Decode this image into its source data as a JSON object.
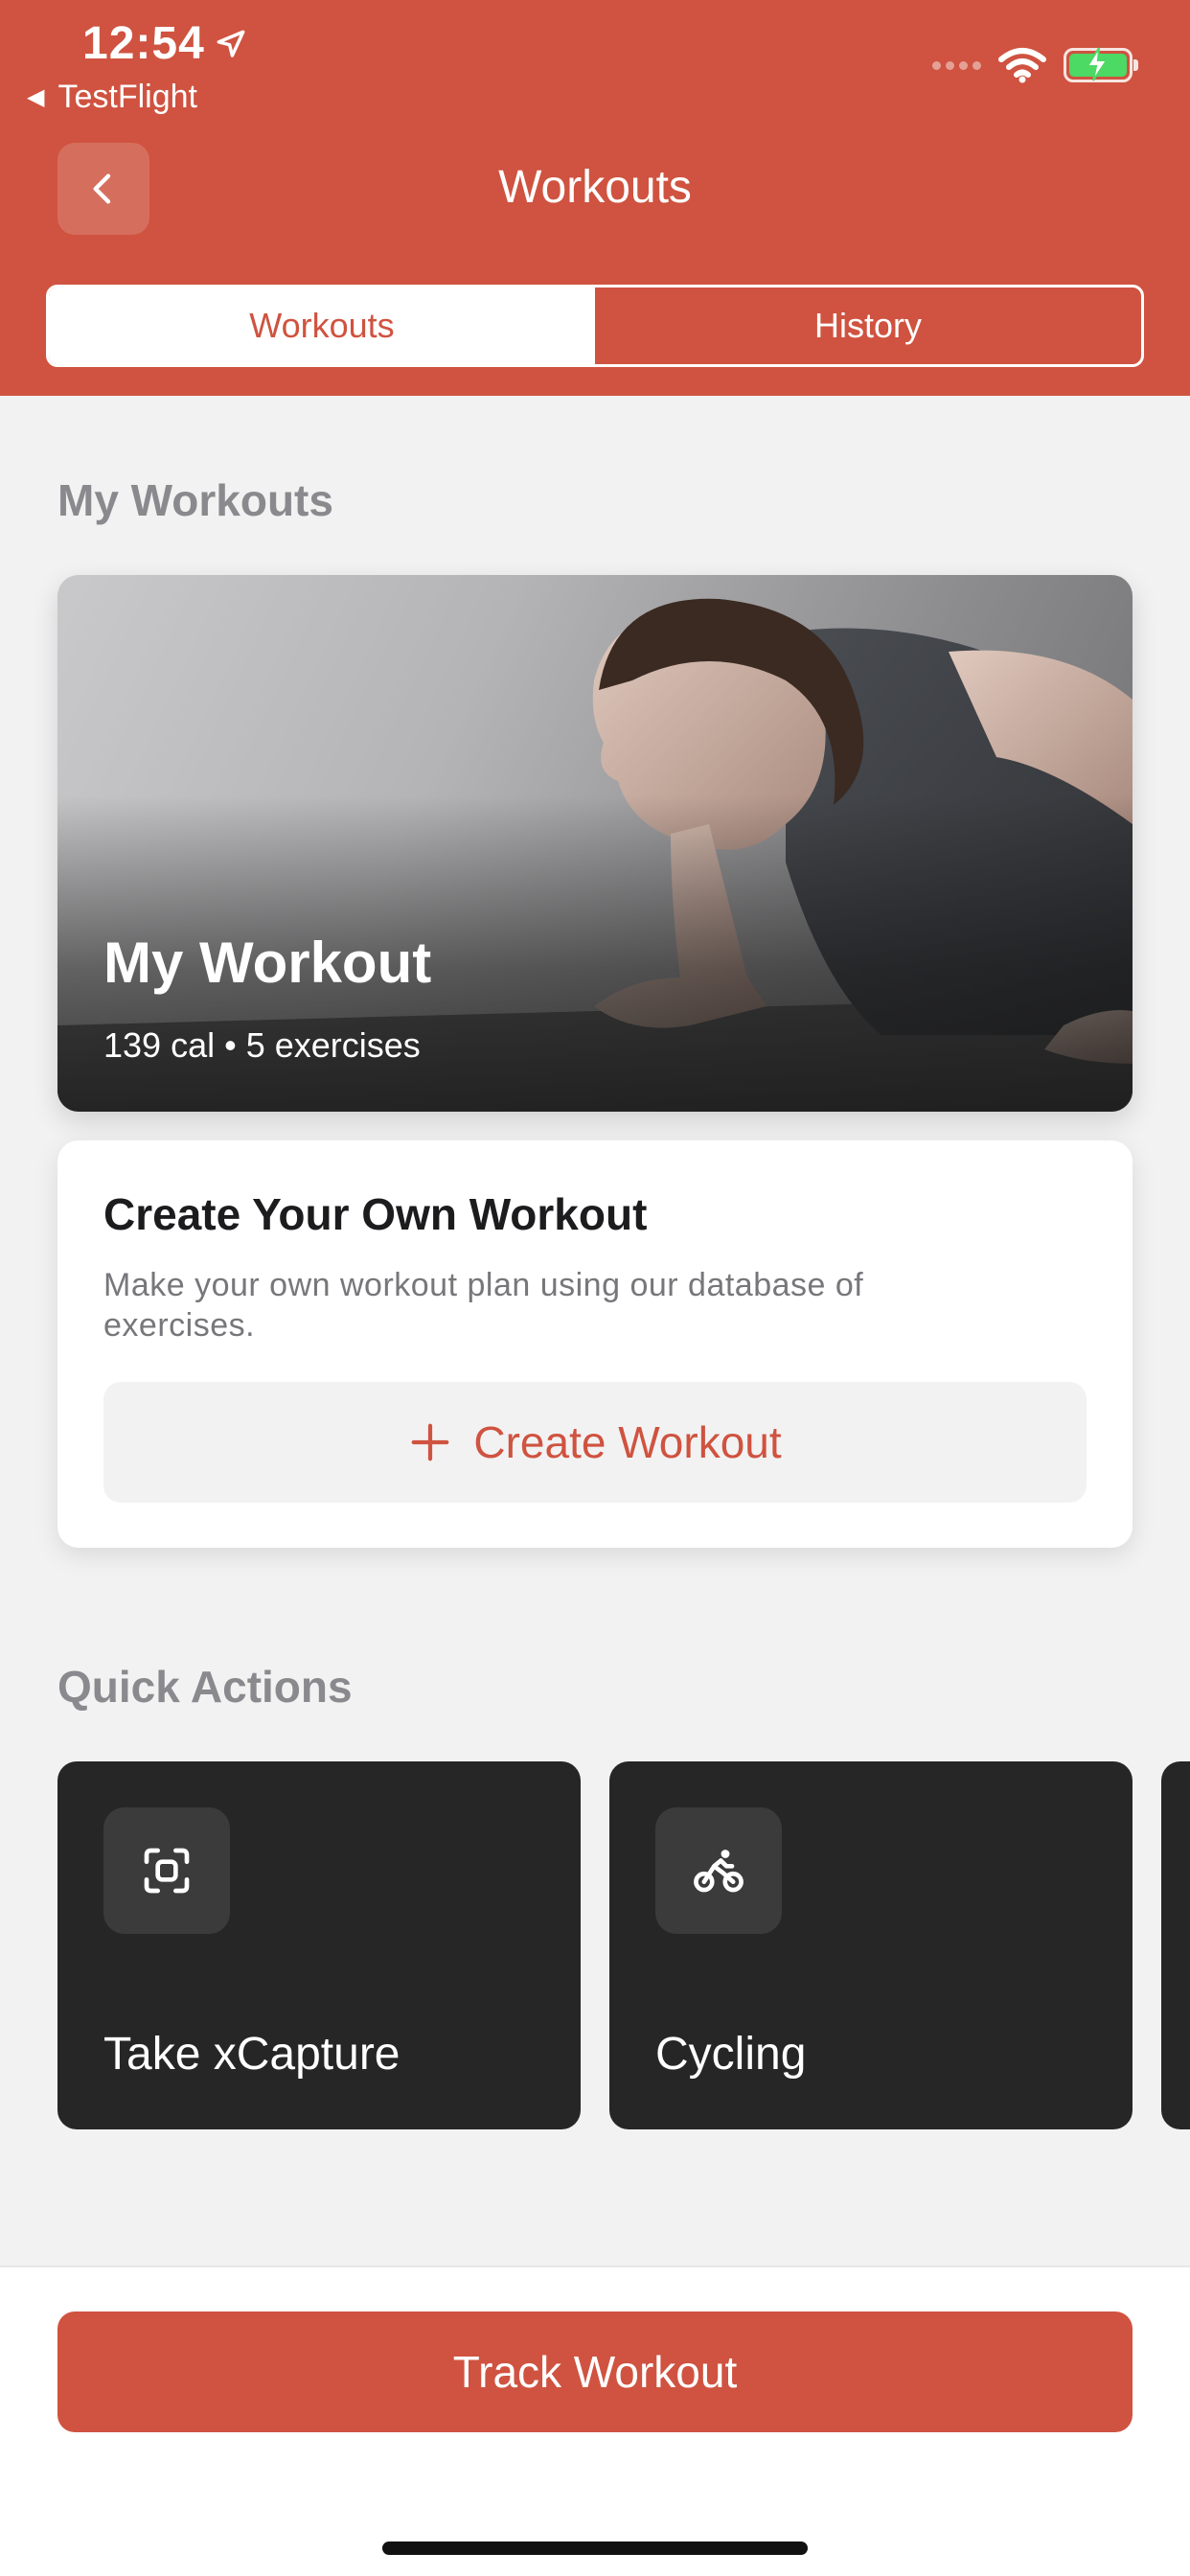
{
  "status_bar": {
    "time": "12:54",
    "back_app": "TestFlight"
  },
  "nav": {
    "title": "Workouts"
  },
  "segments": [
    {
      "label": "Workouts",
      "active": true
    },
    {
      "label": "History",
      "active": false
    }
  ],
  "my_workouts": {
    "section_title": "My Workouts",
    "card": {
      "title": "My Workout",
      "subtitle": "139 cal • 5 exercises"
    }
  },
  "create": {
    "title": "Create Your Own Workout",
    "description": "Make your own workout plan using our database of exercises.",
    "button_label": "Create Workout"
  },
  "quick_actions": {
    "section_title": "Quick Actions",
    "items": [
      {
        "label": "Take xCapture",
        "icon": "scan-icon"
      },
      {
        "label": "Cycling",
        "icon": "cycling-icon"
      }
    ]
  },
  "footer": {
    "track_label": "Track Workout"
  },
  "colors": {
    "accent": "#cf5340",
    "background": "#f2f2f2",
    "dark_card": "#262626"
  }
}
